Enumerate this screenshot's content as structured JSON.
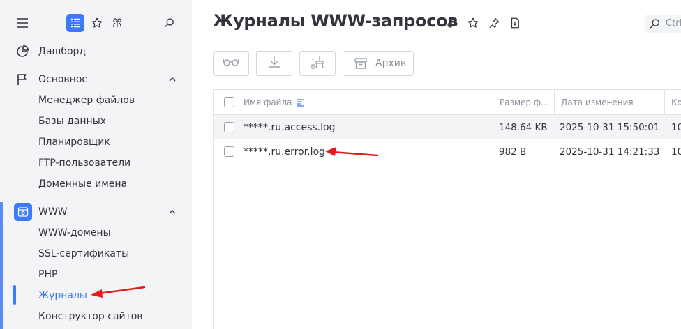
{
  "sidebar": {
    "top_icons": [
      "menu-icon",
      "list-icon",
      "star-icon",
      "favorites-icon",
      "search-icon"
    ],
    "items": [
      {
        "label": "Дашборд",
        "icon": "dashboard-icon"
      },
      {
        "label": "Основное",
        "icon": "flag-icon",
        "expanded": true
      },
      {
        "label": "Менеджер файлов"
      },
      {
        "label": "Базы данных"
      },
      {
        "label": "Планировщик"
      },
      {
        "label": "FTP-пользователи"
      },
      {
        "label": "Доменные имена"
      },
      {
        "label": "WWW",
        "icon": "www-settings-icon",
        "expanded": true
      },
      {
        "label": "WWW-домены"
      },
      {
        "label": "SSL-сертификаты"
      },
      {
        "label": "PHP"
      },
      {
        "label": "Журналы",
        "active": true
      },
      {
        "label": "Конструктор сайтов"
      }
    ]
  },
  "page": {
    "title": "Журналы WWW-запросов",
    "title_icons": [
      "link-icon",
      "star-icon",
      "pin-icon",
      "download-doc-icon"
    ],
    "search_placeholder": "Ctrl"
  },
  "toolbar": {
    "buttons": [
      {
        "icon": "view-icon"
      },
      {
        "icon": "download-icon"
      },
      {
        "icon": "clean-icon"
      },
      {
        "icon": "archive-icon",
        "label": "Архив"
      }
    ]
  },
  "table": {
    "columns": [
      "Имя файла",
      "Размер ф…",
      "Дата изменения",
      "Ко"
    ],
    "rows": [
      {
        "name": "*****.ru.access.log",
        "size": "148.64 KB",
        "date": "2025-10-31 15:50:01",
        "extra": "10"
      },
      {
        "name": "*****.ru.error.log",
        "size": "982 B",
        "date": "2025-10-31 14:21:33",
        "extra": "10"
      }
    ]
  },
  "colors": {
    "accent": "#3d7af5",
    "annotation_arrow": "#e31b1b",
    "sidebar_bg": "#f3f4f6"
  }
}
